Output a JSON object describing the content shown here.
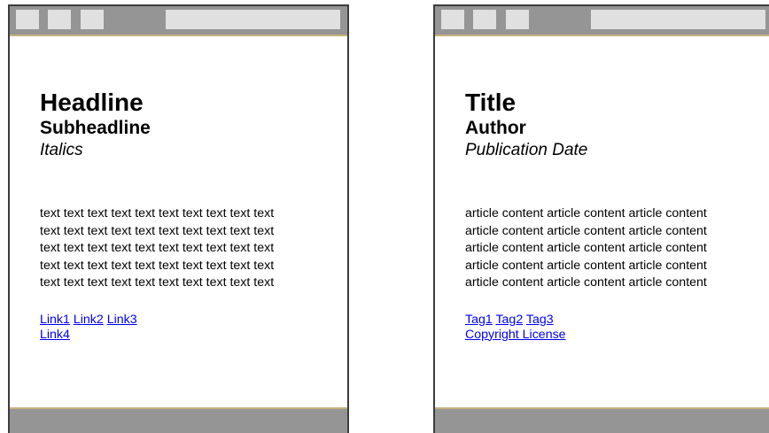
{
  "left_window": {
    "headline": "Headline",
    "subheadline": "Subheadline",
    "italic": "Italics",
    "body_lines": [
      "text text text text text text text text text text",
      "text text text text text text text text text text",
      "text text text text text text text text text text",
      "text text text text text text text text text text",
      "text text text text text text text text text text"
    ],
    "links": [
      "Link1",
      "Link2",
      "Link3",
      "Link4"
    ]
  },
  "right_window": {
    "headline": "Title",
    "subheadline": "Author",
    "italic": "Publication Date",
    "body_lines": [
      "article content article content article content",
      "article content article content article content",
      "article content article content article content",
      "article content article content article content",
      "article content article content article content"
    ],
    "tags": [
      "Tag1",
      "Tag2",
      "Tag3"
    ],
    "license_link": "Copyright License"
  },
  "colors": {
    "titlebar": "#959595",
    "titlebar_buttons": "#e0e0e0",
    "accent_border": "#c6b27e",
    "link": "#0000ee"
  }
}
